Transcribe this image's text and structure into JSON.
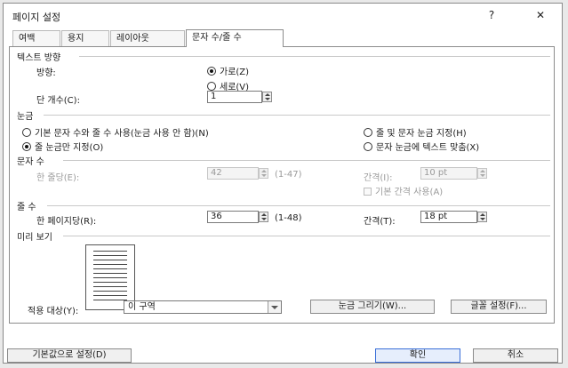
{
  "window": {
    "title": "페이지 설정",
    "help": "?",
    "close": "✕"
  },
  "tabs": [
    {
      "label": "여백",
      "selected": false
    },
    {
      "label": "용지",
      "selected": false
    },
    {
      "label": "레이아웃",
      "selected": false
    },
    {
      "label": "문자 수/줄 수",
      "selected": true
    }
  ],
  "text_direction": {
    "section": "텍스트 방향",
    "label": "방향:",
    "horizontal": {
      "label": "가로(Z)",
      "checked": true
    },
    "vertical": {
      "label": "세로(V)",
      "checked": false
    },
    "columns_label": "단 개수(C):",
    "columns_value": "1"
  },
  "grid": {
    "section": "눈금",
    "opt_default": {
      "label": "기본 문자 수와 줄 수 사용(눈금 사용 안 함)(N)",
      "checked": false
    },
    "opt_lines_only": {
      "label": "줄 눈금만 지정(O)",
      "checked": true
    },
    "opt_lines_chars": {
      "label": "줄 및 문자 눈금 지정(H)",
      "checked": false
    },
    "opt_snap_chars": {
      "label": "문자 눈금에 텍스트 맞춤(X)",
      "checked": false
    }
  },
  "chars": {
    "section": "문자 수",
    "per_line_label": "한 줄당(E):",
    "per_line_value": "42",
    "per_line_range": "(1-47)",
    "pitch_label": "간격(I):",
    "pitch_value": "10 pt",
    "use_default_pitch": {
      "label": "기본 간격 사용(A)",
      "checked": false
    },
    "disabled": true
  },
  "lines": {
    "section": "줄 수",
    "per_page_label": "한 페이지당(R):",
    "per_page_value": "36",
    "per_page_range": "(1-48)",
    "pitch_label": "간격(T):",
    "pitch_value": "18 pt"
  },
  "preview": {
    "section": "미리 보기"
  },
  "apply": {
    "label": "적용 대상(Y):",
    "value": "이 구역"
  },
  "buttons": {
    "draw_grid": "눈금 그리기(W)...",
    "font_settings": "글꼴 설정(F)...",
    "set_default": "기본값으로 설정(D)",
    "ok": "확인",
    "cancel": "취소"
  }
}
